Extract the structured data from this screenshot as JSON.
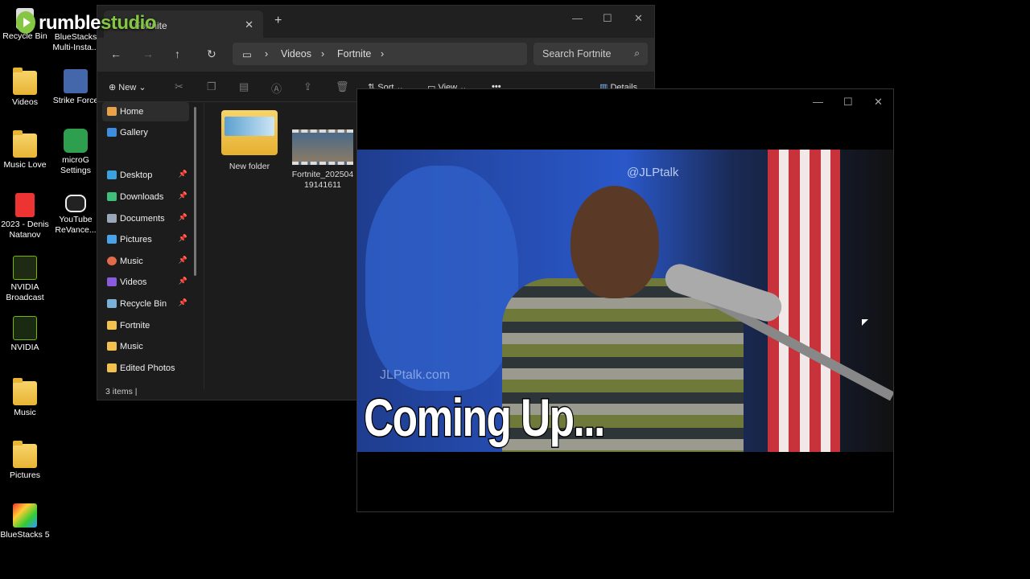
{
  "watermark": {
    "part1": "rumble",
    "part2": "studio"
  },
  "desktop": {
    "col1": [
      {
        "label": "Recycle Bin",
        "icon": "recycle-bin-icon"
      },
      {
        "label": "Videos",
        "icon": "folder-icon"
      },
      {
        "label": "Music Love",
        "icon": "folder-icon"
      },
      {
        "label": "2023 - Denis Natanov",
        "icon": "pdf-icon"
      },
      {
        "label": "NVIDIA Broadcast",
        "icon": "nvidia-broadcast-icon"
      },
      {
        "label": "NVIDIA",
        "icon": "nvidia-icon"
      },
      {
        "label": "Music",
        "icon": "folder-icon"
      },
      {
        "label": "Pictures",
        "icon": "folder-icon"
      },
      {
        "label": "BlueStacks 5",
        "icon": "bluestacks-icon"
      }
    ],
    "col2": [
      {
        "label": "BlueStacks Multi-Insta...",
        "icon": "bluestacks-multi-icon"
      },
      {
        "label": "Strike Force",
        "icon": "strike-force-icon"
      },
      {
        "label": "microG Settings",
        "icon": "microg-icon"
      },
      {
        "label": "YouTube ReVance...",
        "icon": "youtube-revanced-icon"
      }
    ]
  },
  "explorer": {
    "tab_title": "Fortnite",
    "breadcrumb": [
      "Videos",
      "Fortnite"
    ],
    "search_placeholder": "Search Fortnite",
    "toolbar": {
      "new": "New",
      "sort": "Sort",
      "view": "View",
      "more": "•••",
      "details": "Details"
    },
    "sidebar": [
      {
        "label": "Home",
        "color": "#e9a24a",
        "pinned": false
      },
      {
        "label": "Gallery",
        "color": "#3d8de0",
        "pinned": false
      },
      {
        "label": "Desktop",
        "color": "#3aa0e0",
        "pinned": true
      },
      {
        "label": "Downloads",
        "color": "#3fbf7a",
        "pinned": true
      },
      {
        "label": "Documents",
        "color": "#9aa7b8",
        "pinned": true
      },
      {
        "label": "Pictures",
        "color": "#4aa3e8",
        "pinned": true
      },
      {
        "label": "Music",
        "color": "#e06a4a",
        "pinned": true
      },
      {
        "label": "Videos",
        "color": "#8a5ae0",
        "pinned": true
      },
      {
        "label": "Recycle Bin",
        "color": "#7ab0d8",
        "pinned": true
      },
      {
        "label": "Fortnite",
        "color": "#f2c14e",
        "pinned": false
      },
      {
        "label": "Music",
        "color": "#f2c14e",
        "pinned": false
      },
      {
        "label": "Edited Photos",
        "color": "#f2c14e",
        "pinned": false
      }
    ],
    "files": [
      {
        "name": "New folder"
      },
      {
        "name": "Fortnite_20250419141611"
      }
    ],
    "status": "3 items  |"
  },
  "player": {
    "video_watermark": "@JLPtalk",
    "video_watermark2": "JLPtalk.com",
    "caption": "Coming Up..."
  }
}
